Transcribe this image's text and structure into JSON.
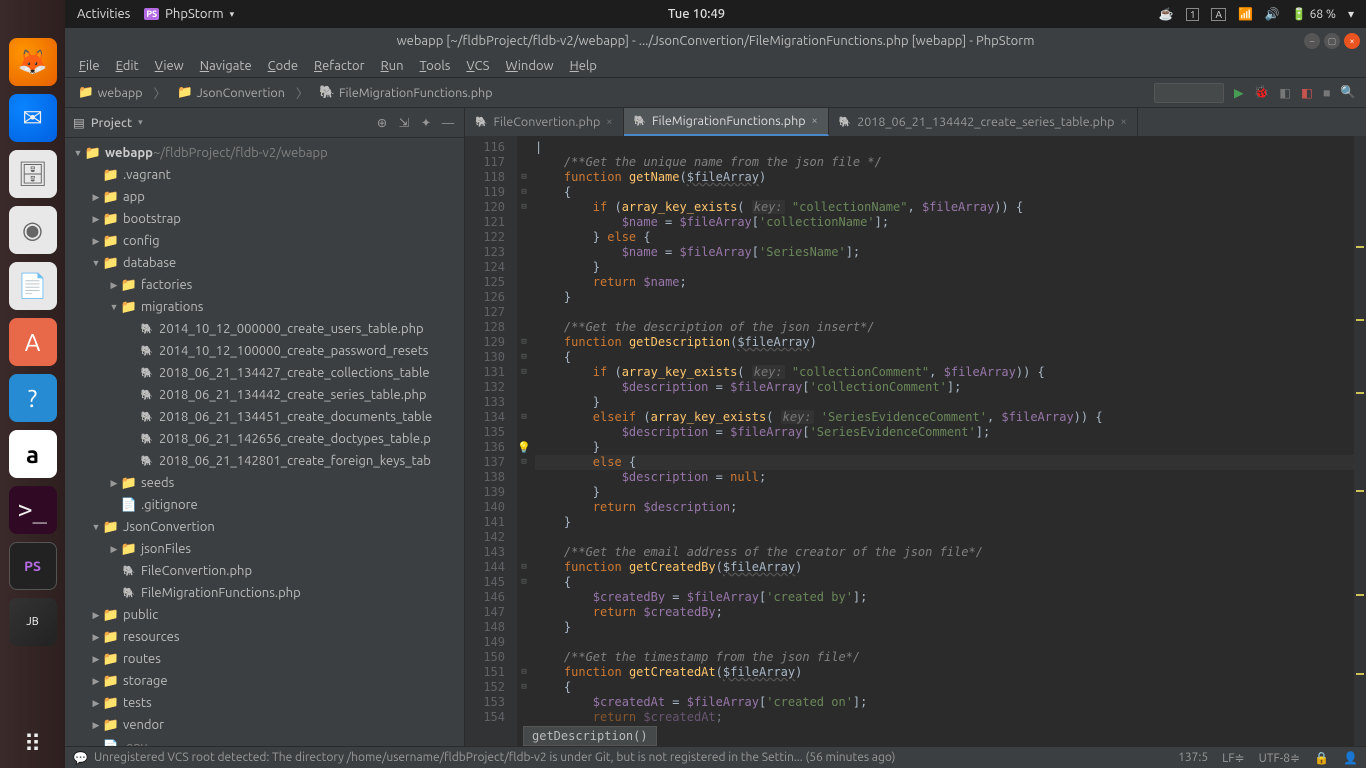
{
  "topbar": {
    "activities": "Activities",
    "app": "PhpStorm",
    "clock": "Tue 10:49",
    "battery": "68 %"
  },
  "window_title": "webapp [~/fldbProject/fldb-v2/webapp] - .../JsonConvertion/FileMigrationFunctions.php [webapp] - PhpStorm",
  "menubar": [
    "File",
    "Edit",
    "View",
    "Navigate",
    "Code",
    "Refactor",
    "Run",
    "Tools",
    "VCS",
    "Window",
    "Help"
  ],
  "breadcrumb": [
    "webapp",
    "JsonConvertion",
    "FileMigrationFunctions.php"
  ],
  "project_panel": {
    "title": "Project"
  },
  "tree": [
    {
      "depth": 0,
      "arrow": "▼",
      "icon": "folder",
      "label": "webapp",
      "suffix": " ~/fldbProject/fldb-v2/webapp",
      "bold": true
    },
    {
      "depth": 1,
      "arrow": "",
      "icon": "folder",
      "label": ".vagrant"
    },
    {
      "depth": 1,
      "arrow": "▶",
      "icon": "folder",
      "label": "app"
    },
    {
      "depth": 1,
      "arrow": "▶",
      "icon": "folder",
      "label": "bootstrap"
    },
    {
      "depth": 1,
      "arrow": "▶",
      "icon": "folder",
      "label": "config"
    },
    {
      "depth": 1,
      "arrow": "▼",
      "icon": "folder",
      "label": "database"
    },
    {
      "depth": 2,
      "arrow": "▶",
      "icon": "folder",
      "label": "factories"
    },
    {
      "depth": 2,
      "arrow": "▼",
      "icon": "folder",
      "label": "migrations"
    },
    {
      "depth": 3,
      "arrow": "",
      "icon": "php",
      "label": "2014_10_12_000000_create_users_table.php"
    },
    {
      "depth": 3,
      "arrow": "",
      "icon": "php",
      "label": "2014_10_12_100000_create_password_resets"
    },
    {
      "depth": 3,
      "arrow": "",
      "icon": "php",
      "label": "2018_06_21_134427_create_collections_table"
    },
    {
      "depth": 3,
      "arrow": "",
      "icon": "php",
      "label": "2018_06_21_134442_create_series_table.php"
    },
    {
      "depth": 3,
      "arrow": "",
      "icon": "php",
      "label": "2018_06_21_134451_create_documents_table"
    },
    {
      "depth": 3,
      "arrow": "",
      "icon": "php",
      "label": "2018_06_21_142656_create_doctypes_table.p"
    },
    {
      "depth": 3,
      "arrow": "",
      "icon": "php",
      "label": "2018_06_21_142801_create_foreign_keys_tab"
    },
    {
      "depth": 2,
      "arrow": "▶",
      "icon": "folder",
      "label": "seeds"
    },
    {
      "depth": 2,
      "arrow": "",
      "icon": "file",
      "label": ".gitignore"
    },
    {
      "depth": 1,
      "arrow": "▼",
      "icon": "folder",
      "label": "JsonConvertion"
    },
    {
      "depth": 2,
      "arrow": "▶",
      "icon": "folder",
      "label": "jsonFiles"
    },
    {
      "depth": 2,
      "arrow": "",
      "icon": "php",
      "label": "FileConvertion.php"
    },
    {
      "depth": 2,
      "arrow": "",
      "icon": "php",
      "label": "FileMigrationFunctions.php"
    },
    {
      "depth": 1,
      "arrow": "▶",
      "icon": "folder",
      "label": "public"
    },
    {
      "depth": 1,
      "arrow": "▶",
      "icon": "folder",
      "label": "resources"
    },
    {
      "depth": 1,
      "arrow": "▶",
      "icon": "folder",
      "label": "routes"
    },
    {
      "depth": 1,
      "arrow": "▶",
      "icon": "folder",
      "label": "storage"
    },
    {
      "depth": 1,
      "arrow": "▶",
      "icon": "folder-green",
      "label": "tests"
    },
    {
      "depth": 1,
      "arrow": "▶",
      "icon": "folder",
      "label": "vendor"
    },
    {
      "depth": 1,
      "arrow": "",
      "icon": "file",
      "label": ".env",
      "dim": true
    }
  ],
  "tabs": [
    {
      "label": "FileConvertion.php",
      "active": false
    },
    {
      "label": "FileMigrationFunctions.php",
      "active": true
    },
    {
      "label": "2018_06_21_134442_create_series_table.php",
      "active": false
    }
  ],
  "code": {
    "first_line": 116,
    "lines": [
      {
        "t": "|",
        "cls": ""
      },
      {
        "html": "    <span class='comment'>/**Get the unique name from the json file */</span>"
      },
      {
        "html": "    <span class='kw'>function</span> <span class='fn'>getName</span>(<span class='param'>$fileArray</span>)"
      },
      {
        "html": "    {"
      },
      {
        "html": "        <span class='kw'>if</span> (<span class='fn'>array_key_exists</span>( <span class='hint'>key:</span> <span class='str'>\"collectionName\"</span>, <span class='var'>$fileArray</span>)) {"
      },
      {
        "html": "            <span class='var'>$name</span> = <span class='var'>$fileArray</span>[<span class='str'>'collectionName'</span>];"
      },
      {
        "html": "        } <span class='kw'>else</span> {"
      },
      {
        "html": "            <span class='var'>$name</span> = <span class='var'>$fileArray</span>[<span class='str'>'SeriesName'</span>];"
      },
      {
        "html": "        }"
      },
      {
        "html": "        <span class='kw'>return</span> <span class='var'>$name</span>;"
      },
      {
        "html": "    }"
      },
      {
        "html": ""
      },
      {
        "html": "    <span class='comment'>/**Get the description of the json insert*/</span>"
      },
      {
        "html": "    <span class='kw'>function</span> <span class='fn'>getDescription</span>(<span class='param'>$fileArray</span>)"
      },
      {
        "html": "    {"
      },
      {
        "html": "        <span class='kw'>if</span> (<span class='fn'>array_key_exists</span>( <span class='hint'>key:</span> <span class='str'>\"collectionComment\"</span>, <span class='var'>$fileArray</span>)) {"
      },
      {
        "html": "            <span class='var'>$description</span> = <span class='var'>$fileArray</span>[<span class='str'>'collectionComment'</span>];"
      },
      {
        "html": "        }"
      },
      {
        "html": "        <span class='kw'>elseif</span> (<span class='fn'>array_key_exists</span>( <span class='hint'>key:</span> <span class='str'>'SeriesEvidenceComment'</span>, <span class='var'>$fileArray</span>)) {"
      },
      {
        "html": "            <span class='var'>$description</span> = <span class='var'>$fileArray</span>[<span class='str'>'SeriesEvidenceComment'</span>];"
      },
      {
        "html": "        }",
        "bulb": true
      },
      {
        "html": "        <span class='kw'>else</span> {",
        "hl": true
      },
      {
        "html": "            <span class='var'>$description</span> = <span class='kw'>null</span>;"
      },
      {
        "html": "        }"
      },
      {
        "html": "        <span class='kw'>return</span> <span class='var'>$description</span>;"
      },
      {
        "html": "    }"
      },
      {
        "html": ""
      },
      {
        "html": "    <span class='comment'>/**Get the email address of the creator of the json file*/</span>"
      },
      {
        "html": "    <span class='kw'>function</span> <span class='fn'>getCreatedBy</span>(<span class='param'>$fileArray</span>)"
      },
      {
        "html": "    {"
      },
      {
        "html": "        <span class='var'>$createdBy</span> = <span class='var'>$fileArray</span>[<span class='str'>'created by'</span>];"
      },
      {
        "html": "        <span class='kw'>return</span> <span class='var'>$createdBy</span>;"
      },
      {
        "html": "    }"
      },
      {
        "html": ""
      },
      {
        "html": "    <span class='comment'>/**Get the timestamp from the json file*/</span>"
      },
      {
        "html": "    <span class='kw'>function</span> <span class='fn'>getCreatedAt</span>(<span class='param'>$fileArray</span>)"
      },
      {
        "html": "    {"
      },
      {
        "html": "        <span class='var'>$createdAt</span> = <span class='var'>$fileArray</span>[<span class='str'>'created on'</span>];"
      },
      {
        "html": "        <span class='kw'>return</span> <span class='var'>$createdAt</span>;",
        "dim": true
      }
    ]
  },
  "hint_popup": "getDescription()",
  "statusbar": {
    "vcs_msg": "Unregistered VCS root detected: The directory /home/username/fldbProject/fldb-v2 is under Git, but is not registered in the Settin... (56 minutes ago)",
    "pos": "137:5",
    "sep": "LF",
    "enc": "UTF-8"
  }
}
